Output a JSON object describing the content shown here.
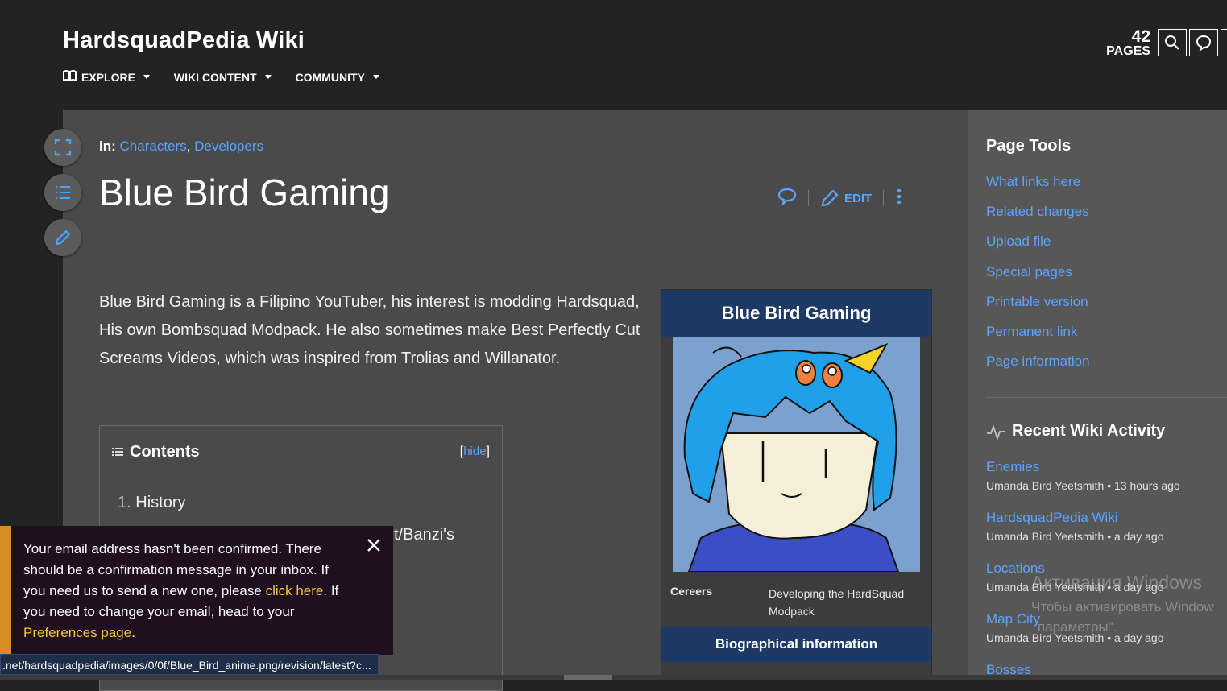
{
  "header": {
    "wiki_title": "HardsquadPedia Wiki",
    "nav": [
      {
        "label": "EXPLORE",
        "icon": "book-icon"
      },
      {
        "label": "WIKI CONTENT"
      },
      {
        "label": "COMMUNITY"
      }
    ],
    "pages_count": "42",
    "pages_label": "PAGES"
  },
  "article": {
    "categories_prefix": "in:",
    "categories": [
      "Characters",
      "Developers"
    ],
    "title": "Blue Bird Gaming",
    "edit_label": "EDIT",
    "intro": "Blue Bird Gaming is a Filipino YouTuber, his interest is modding Hardsquad, His own Bombsquad Modpack. He also sometimes make Best Perfectly Cut Screams Videos, which was inspired from Trolias and Willanator.",
    "toc": {
      "title": "Contents",
      "hide_open": "[",
      "hide_label": "hide",
      "hide_close": "]",
      "items": [
        {
          "num": "1.",
          "label": "History"
        },
        {
          "label": "t/Banzi's"
        }
      ]
    }
  },
  "infobox": {
    "title": "Blue Bird Gaming",
    "rows": [
      {
        "key": "Cereers",
        "value": "Developing the HardSquad Modpack"
      }
    ],
    "section": "Biographical information"
  },
  "rail": {
    "page_tools_title": "Page Tools",
    "tools": [
      "What links here",
      "Related changes",
      "Upload file",
      "Special pages",
      "Printable version",
      "Permanent link",
      "Page information"
    ],
    "activity_title": "Recent Wiki Activity",
    "activity": [
      {
        "title": "Enemies",
        "meta": "Umanda Bird Yeetsmith • 13 hours ago"
      },
      {
        "title": "HardsquadPedia Wiki",
        "meta": "Umanda Bird Yeetsmith • a day ago"
      },
      {
        "title": "Locations",
        "meta": "Umanda Bird Yeetsmith • a day ago"
      },
      {
        "title": "Map City",
        "meta": "Umanda Bird Yeetsmith • a day ago"
      },
      {
        "title": "Bosses"
      }
    ]
  },
  "banner": {
    "text_1": "Your email address hasn't been confirmed. There should be a confirmation message in your inbox. If you need us to send a new one, please ",
    "link_1": "click here",
    "text_2": ". If you need to change your email, head to your ",
    "link_2": "Preferences page",
    "text_3": "."
  },
  "status_url": ".net/hardsquadpedia/images/0/0f/Blue_Bird_anime.png/revision/latest?c...",
  "watermark": {
    "line1": "Активация Windows",
    "line2": "Чтобы активировать Window",
    "line3": "параметры\"."
  },
  "colors": {
    "link": "#5aa3ff",
    "infobox_header": "#1d3a66",
    "banner_accent": "#d98a25",
    "banner_link": "#f3c43c"
  }
}
